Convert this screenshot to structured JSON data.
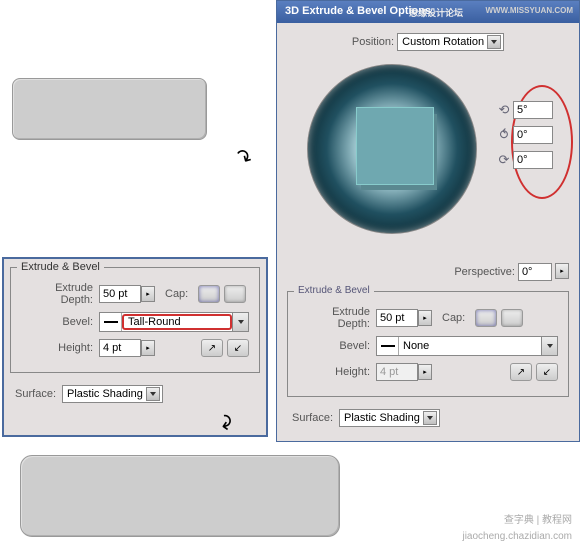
{
  "dialog": {
    "title": "3D Extrude & Bevel Options",
    "title_ch": "思缘设计论坛",
    "title_url": "WWW.MISSYUAN.COM",
    "position_label": "Position:",
    "position_value": "Custom Rotation",
    "rot": [
      "5°",
      "0°",
      "0°"
    ],
    "perspective_label": "Perspective:",
    "perspective_value": "0°"
  },
  "ebR": {
    "legend": "Extrude & Bevel",
    "depth_label": "Extrude Depth:",
    "depth_value": "50 pt",
    "cap_label": "Cap:",
    "bevel_label": "Bevel:",
    "bevel_value": "None",
    "height_label": "Height:",
    "height_value": "4 pt",
    "surface_label": "Surface:",
    "surface_value": "Plastic Shading"
  },
  "ebL": {
    "legend": "Extrude & Bevel",
    "depth_label": "Extrude Depth:",
    "depth_value": "50 pt",
    "cap_label": "Cap:",
    "bevel_label": "Bevel:",
    "bevel_value": "Tall-Round",
    "height_label": "Height:",
    "height_value": "4 pt",
    "surface_label": "Surface:",
    "surface_value": "Plastic Shading"
  },
  "footer1": "查字典 | 教程网",
  "footer2": "jiaocheng.chazidian.com"
}
